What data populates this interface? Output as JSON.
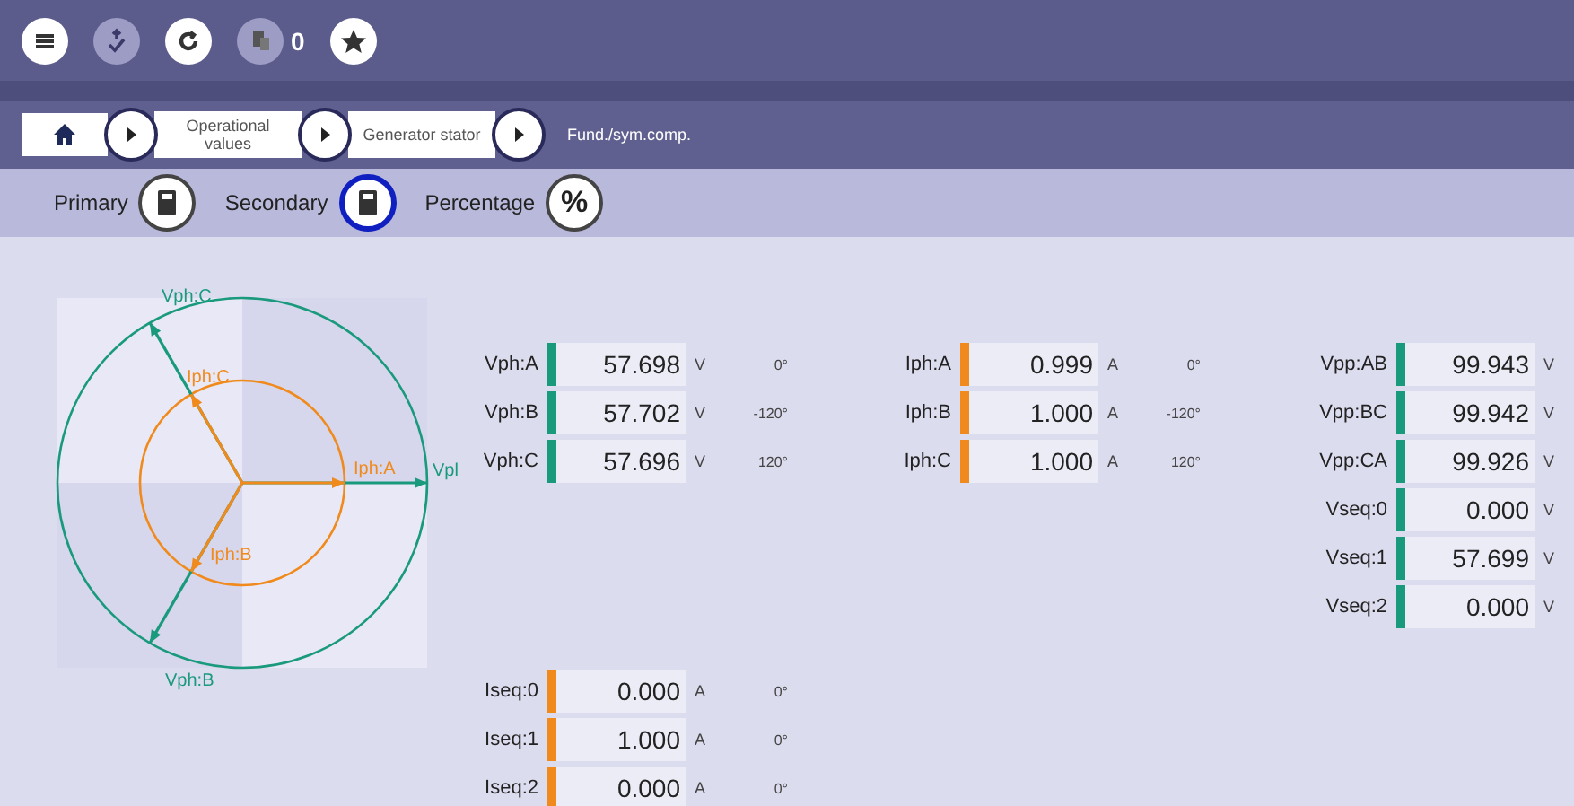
{
  "toolbar": {
    "badge_count": "0"
  },
  "breadcrumb": {
    "items": [
      {
        "label": "Operational values",
        "kind": "box"
      },
      {
        "label": "Generator stator",
        "kind": "box"
      },
      {
        "label": "Fund./sym.comp.",
        "kind": "current"
      }
    ]
  },
  "view_modes": [
    {
      "label": "Primary",
      "kind": "primary",
      "selected": false
    },
    {
      "label": "Secondary",
      "kind": "secondary",
      "selected": true
    },
    {
      "label": "Percentage",
      "kind": "percent",
      "symbol": "%",
      "selected": false
    }
  ],
  "phasor_diagram": {
    "voltage_labels": [
      "Vph:C",
      "Vph:B",
      "Vpl"
    ],
    "current_labels": [
      "Iph:C",
      "Iph:B",
      "Iph:A"
    ]
  },
  "measurement_groups": [
    {
      "kind": "voltage",
      "rows": [
        {
          "label": "Vph:A",
          "value": "57.698",
          "unit": "V",
          "angle": "0°"
        },
        {
          "label": "Vph:B",
          "value": "57.702",
          "unit": "V",
          "angle": "-120°"
        },
        {
          "label": "Vph:C",
          "value": "57.696",
          "unit": "V",
          "angle": "120°"
        }
      ]
    },
    {
      "kind": "current",
      "rows": [
        {
          "label": "Iph:A",
          "value": "0.999",
          "unit": "A",
          "angle": "0°"
        },
        {
          "label": "Iph:B",
          "value": "1.000",
          "unit": "A",
          "angle": "-120°"
        },
        {
          "label": "Iph:C",
          "value": "1.000",
          "unit": "A",
          "angle": "120°"
        }
      ]
    },
    {
      "kind": "voltage",
      "rows": [
        {
          "label": "Vpp:AB",
          "value": "99.943",
          "unit": "V"
        },
        {
          "label": "Vpp:BC",
          "value": "99.942",
          "unit": "V"
        },
        {
          "label": "Vpp:CA",
          "value": "99.926",
          "unit": "V"
        },
        {
          "label": "Vseq:0",
          "value": "0.000",
          "unit": "V"
        },
        {
          "label": "Vseq:1",
          "value": "57.699",
          "unit": "V"
        },
        {
          "label": "Vseq:2",
          "value": "0.000",
          "unit": "V"
        }
      ]
    },
    {
      "kind": "current",
      "rows": [
        {
          "label": "Iseq:0",
          "value": "0.000",
          "unit": "A",
          "angle": "0°"
        },
        {
          "label": "Iseq:1",
          "value": "1.000",
          "unit": "A",
          "angle": "0°"
        },
        {
          "label": "Iseq:2",
          "value": "0.000",
          "unit": "A",
          "angle": "0°"
        }
      ]
    }
  ]
}
